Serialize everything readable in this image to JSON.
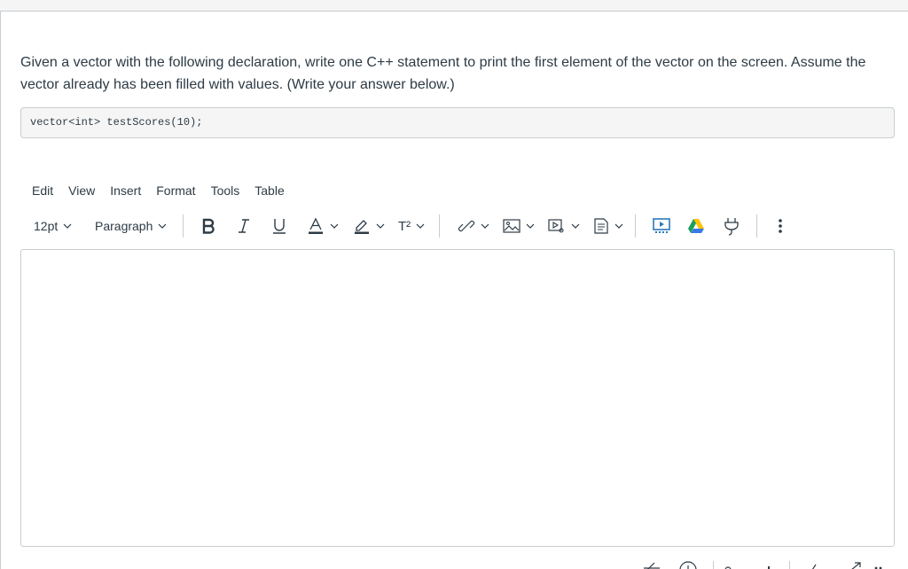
{
  "question": {
    "text": "Given a vector with the following declaration, write one C++ statement to print the first element of the vector on the screen. Assume the vector already has been filled with values. (Write your answer below.)"
  },
  "code_snippet": "vector<int> testScores(10);",
  "editor": {
    "menu": [
      "Edit",
      "View",
      "Insert",
      "Format",
      "Tools",
      "Table"
    ],
    "font_size": "12pt",
    "block_format": "Paragraph",
    "superscript_label": "T²",
    "toolbar_icons": [
      "bold-icon",
      "italic-icon",
      "underline-icon",
      "text-color-icon",
      "highlight-color-icon",
      "superscript-icon",
      "link-icon",
      "image-icon",
      "media-icon",
      "document-icon",
      "apps-icon",
      "google-drive-icon",
      "plugin-icon",
      "more-icon"
    ],
    "content": ""
  },
  "colors": {
    "text": "#2d3b45",
    "border": "#c7cdd1",
    "code_bg": "#f5f5f5",
    "apps_blue": "#2b7abc"
  }
}
